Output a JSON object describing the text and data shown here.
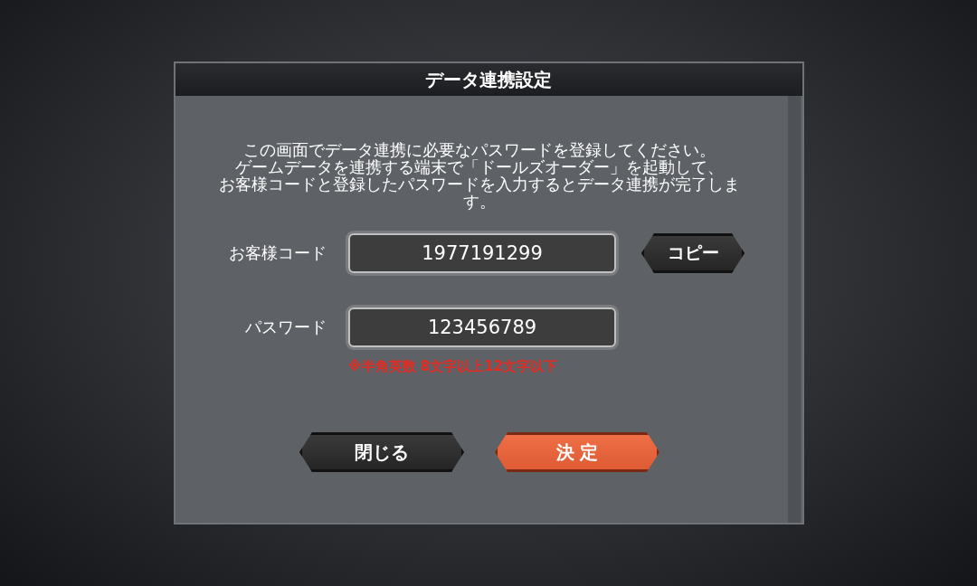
{
  "dialog": {
    "title": "データ連携設定",
    "message_lines": [
      "この画面でデータ連携に必要なパスワードを登録してください。",
      "ゲームデータを連携する端末で「ドールズオーダー」を起動して、",
      "お客様コードと登録したパスワードを入力するとデータ連携が完了します。"
    ],
    "fields": [
      {
        "label": "お客様コード",
        "value": "1977191299",
        "action": "コピー"
      },
      {
        "label": "パスワード",
        "value": "123456789",
        "hint": "※半角英数 8文字以上12文字以下"
      }
    ],
    "buttons": [
      {
        "label": "閉じる",
        "kind": "secondary"
      },
      {
        "label": "決 定",
        "kind": "primary"
      }
    ]
  }
}
